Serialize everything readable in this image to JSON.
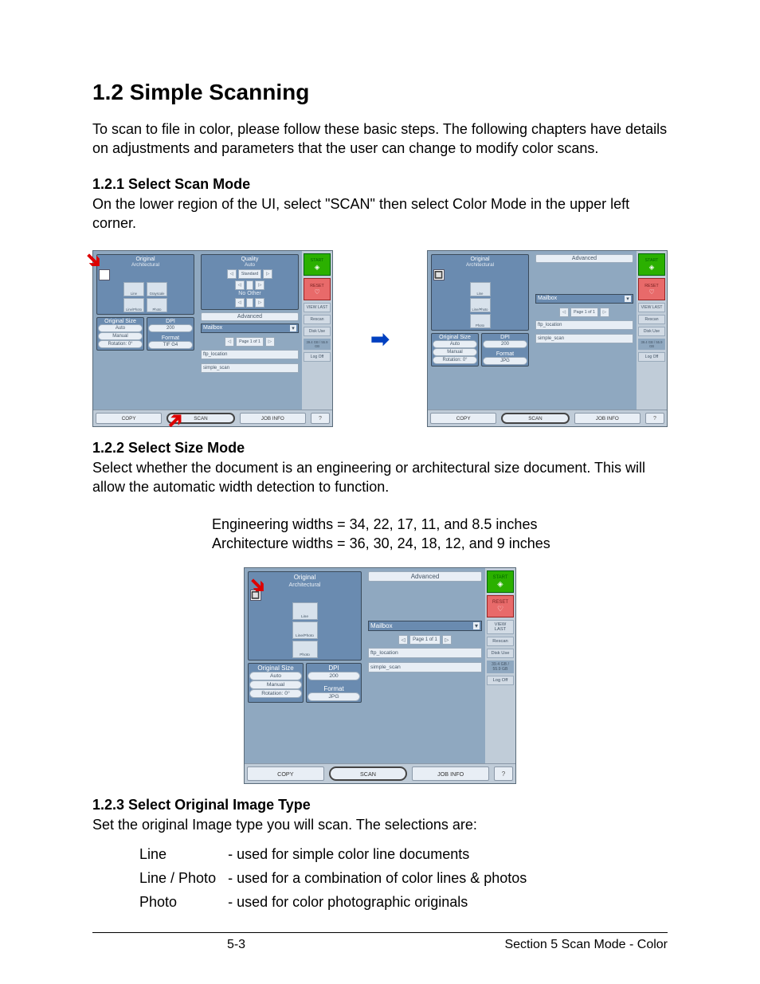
{
  "heading": "1.2  Simple Scanning",
  "intro": "To scan to file in color, please follow these basic steps. The following chapters have details on adjustments and parameters that the user can change to modify color scans.",
  "s121": {
    "title": "1.2.1  Select Scan Mode",
    "text": "On the lower region of the UI, select \"SCAN\" then select Color Mode in the upper left corner."
  },
  "s122": {
    "title": "1.2.2  Select Size Mode",
    "text": "Select whether the document is an engineering or architectural size document. This will allow the automatic width detection to function.",
    "widthsEng": "Engineering widths = 34, 22, 17, 11, and 8.5 inches",
    "widthsArch": "Architecture widths = 36, 30, 24, 18, 12, and 9 inches"
  },
  "s123": {
    "title": "1.2.3  Select Original Image Type",
    "text": "Set the original Image type you will scan. The selections are:",
    "types": [
      [
        "Line",
        "- used for simple color line documents"
      ],
      [
        "Line / Photo",
        "- used for a combination of color lines & photos"
      ],
      [
        "Photo",
        "- used for color photographic originals"
      ]
    ]
  },
  "footer": {
    "page": "5-3",
    "section": "Section 5    Scan Mode - Color"
  },
  "ui": {
    "orig": "Original",
    "arch": "Architectural",
    "quality": "Quality",
    "auto": "Auto",
    "line": "Line",
    "grayscale": "Grayscale",
    "linePhoto": "Line/Photo",
    "photo": "Photo",
    "noOther": "No Other",
    "standard": "Standard",
    "advanced": "Advanced",
    "mailbox": "Mailbox",
    "pageOf": "Page\n1 of 1",
    "ftp": "ftp_location",
    "simpleScan": "simple_scan",
    "origSize": "Original Size",
    "dpi": "DPI",
    "dpiVal": "200",
    "autoPill": "Auto",
    "manual": "Manual",
    "rotation": "Rotation: 0°",
    "format": "Format",
    "tifg4": "TIF G4",
    "jpg": "JPG",
    "start": "START",
    "reset": "RESET",
    "viewlast": "VIEW LAST",
    "rescan": "Rescan",
    "diskuse": "Disk Use",
    "disk": "39.4 GB / 55.9 GB",
    "logoff": "Log Off",
    "copy": "COPY",
    "scan": "SCAN",
    "jobinfo": "JOB INFO",
    "help": "?"
  }
}
